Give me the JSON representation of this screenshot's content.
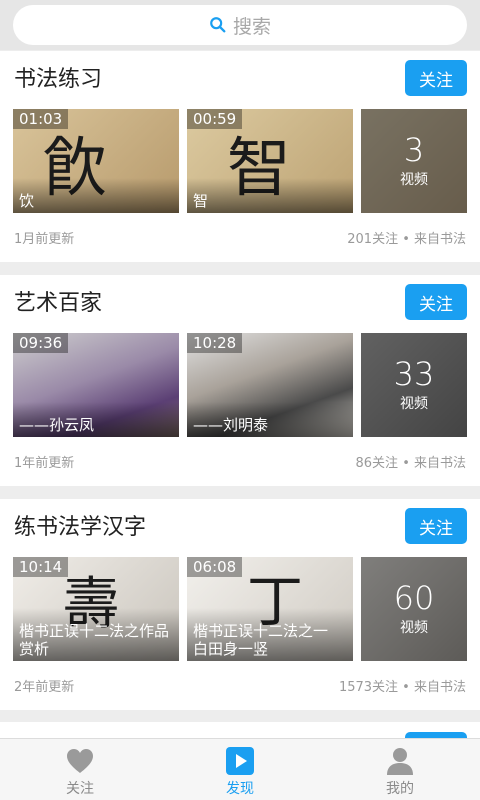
{
  "search": {
    "placeholder": "搜索"
  },
  "cards": [
    {
      "title": "书法练习",
      "follow_label": "关注",
      "thumbs": [
        {
          "duration": "01:03",
          "caption": "饮"
        },
        {
          "duration": "00:59",
          "caption": "智"
        }
      ],
      "count": {
        "number": "3",
        "label": "视频"
      },
      "updated": "1月前更新",
      "stats": "201关注 • 来自书法"
    },
    {
      "title": "艺术百家",
      "follow_label": "关注",
      "thumbs": [
        {
          "duration": "09:36",
          "caption": "——孙云凤"
        },
        {
          "duration": "10:28",
          "caption": "——刘明泰"
        }
      ],
      "count": {
        "number": "33",
        "label": "视频"
      },
      "updated": "1年前更新",
      "stats": "86关注 • 来自书法"
    },
    {
      "title": "练书法学汉字",
      "follow_label": "关注",
      "thumbs": [
        {
          "duration": "10:14",
          "caption": "楷书正误十二法之作品赏析"
        },
        {
          "duration": "06:08",
          "caption": "楷书正误十二法之一 白田身一竖"
        }
      ],
      "count": {
        "number": "60",
        "label": "视频"
      },
      "updated": "2年前更新",
      "stats": "1573关注 • 来自书法"
    }
  ],
  "tabbar": {
    "items": [
      {
        "label": "关注",
        "icon": "heart-icon"
      },
      {
        "label": "发现",
        "icon": "play-icon"
      },
      {
        "label": "我的",
        "icon": "user-icon"
      }
    ],
    "active_color": "#1a9ff1"
  }
}
